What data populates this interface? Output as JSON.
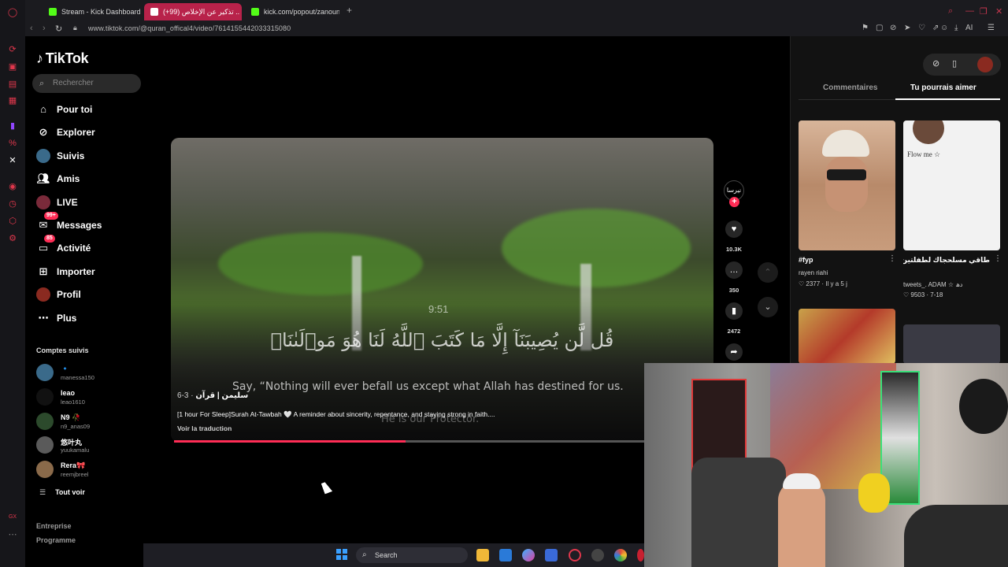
{
  "browser": {
    "tabs": [
      {
        "label": "Stream - Kick Dashboard",
        "favicon_color": "#53fc18"
      },
      {
        "label": "(+99) تذكير عن الإخلاص ..",
        "favicon_color": "#ffffff"
      },
      {
        "label": "kick.com/popout/zanouni/c",
        "favicon_color": "#53fc18"
      }
    ],
    "new_tab": "+",
    "url": "www.tiktok.com/@quran_offical4/video/7614155442033315080",
    "ai_label": "AI"
  },
  "tiktok": {
    "logo": "TikTok",
    "search_placeholder": "Rechercher",
    "nav": [
      {
        "label": "Pour toi",
        "icon": "home-icon"
      },
      {
        "label": "Explorer",
        "icon": "compass-icon"
      },
      {
        "label": "Suivis",
        "icon": "following-icon"
      },
      {
        "label": "Amis",
        "icon": "friends-icon"
      },
      {
        "label": "LIVE",
        "icon": "live-icon"
      },
      {
        "label": "Messages",
        "icon": "messages-icon",
        "badge": "99+"
      },
      {
        "label": "Activité",
        "icon": "activity-icon",
        "badge": "85"
      },
      {
        "label": "Importer",
        "icon": "upload-icon"
      },
      {
        "label": "Profil",
        "icon": "profile-icon"
      },
      {
        "label": "Plus",
        "icon": "more-icon"
      }
    ],
    "followed_title": "Comptes suivis",
    "followed": [
      {
        "name": "🔹",
        "handle": "manessa150",
        "color": "#3a6a8a"
      },
      {
        "name": "leao",
        "handle": "leao1610",
        "color": "#111111"
      },
      {
        "name": "N9 🥀",
        "handle": "n9_anas09",
        "color": "#2c4a2c"
      },
      {
        "name": "悠叶丸",
        "handle": "yuukamalu",
        "color": "#5a5a5a"
      },
      {
        "name": "Rera🎀",
        "handle": "reemjbreel",
        "color": "#8a6a4a"
      }
    ],
    "see_all": "Tout voir",
    "footer": [
      "Entreprise",
      "Programme"
    ]
  },
  "video": {
    "timestamp": "9:51",
    "arabic_text": "قُل لَّن يُصِيبَنَآ إِلَّا مَا كَتَبَ ٱللَّهُ لَنَا هُوَ مَوۡلَىٰنَاۚ",
    "subtitle_1": "Say, “Nothing will ever befall us except what Allah has destined for us.",
    "subtitle_2": "He is our Protector.",
    "author": "سليمن | قرآن",
    "date": " · 3-6",
    "description": "[1 hour For Sleep]Surah At-Tawbah 🤍 A reminder about sincerity, repentance, and staying strong in faith....",
    "translate": "Voir la traduction",
    "progress_fraction": 0.49
  },
  "actions": {
    "creator_tag": "نيرسا",
    "likes": "10.3K",
    "comments": "350",
    "saves": "2472"
  },
  "right_panel": {
    "tabs": [
      "Commentaires",
      "Tu pourrais aimer"
    ],
    "active_tab": "Tu pourrais aimer",
    "recommendations": [
      {
        "title": "#fyp",
        "user": "rayen riahi",
        "meta": "♡ 2377 · Il y a 5 j"
      },
      {
        "title": "طاقي مسلحجاك لطفلتين #تصميمي #تصميم فيديوهات 🎬🎶🎵",
        "user": "tweets_. ADAM ☆ دھ",
        "meta": "♡ 9503 · 7-18",
        "overlay": "Flow me ☆"
      }
    ]
  },
  "taskbar": {
    "search": "Search"
  }
}
